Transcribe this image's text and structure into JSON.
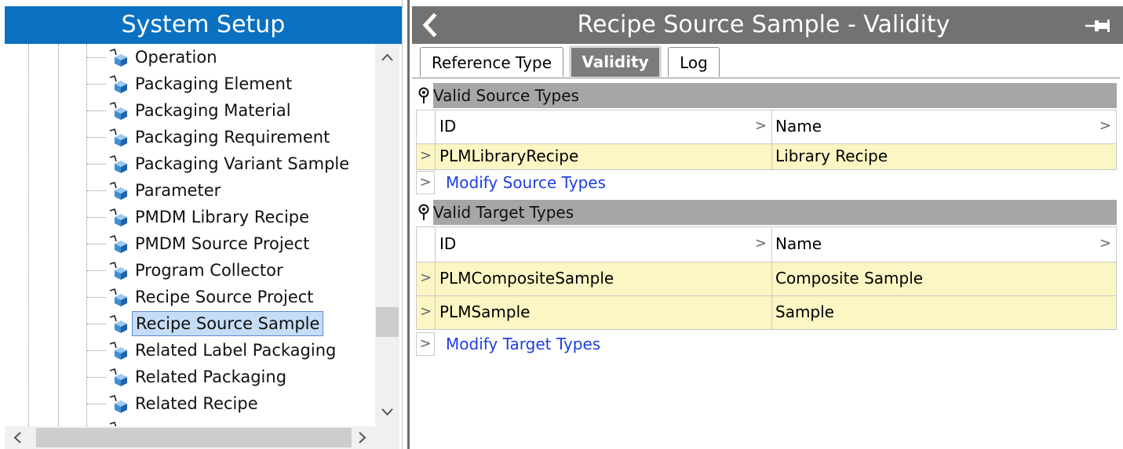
{
  "left_panel": {
    "title": "System Setup",
    "tree_items": [
      {
        "label": "Operation"
      },
      {
        "label": "Packaging Element"
      },
      {
        "label": "Packaging Material"
      },
      {
        "label": "Packaging Requirement"
      },
      {
        "label": "Packaging Variant Sample"
      },
      {
        "label": "Parameter"
      },
      {
        "label": "PMDM Library Recipe"
      },
      {
        "label": "PMDM Source Project"
      },
      {
        "label": "Program Collector"
      },
      {
        "label": "Recipe Source Project"
      },
      {
        "label": "Recipe Source Sample"
      },
      {
        "label": "Related Label Packaging"
      },
      {
        "label": "Related Packaging"
      },
      {
        "label": "Related Recipe"
      }
    ],
    "selected_item": "Recipe Source Sample",
    "scroll_up_icon": "^",
    "scroll_down_icon": "v",
    "scroll_left_icon": "<",
    "scroll_right_icon": ">"
  },
  "right_panel": {
    "title": "Recipe Source Sample - Validity",
    "back_icon": "<",
    "tabs": [
      {
        "label": "Reference Type"
      },
      {
        "label": "Validity"
      },
      {
        "label": "Log"
      }
    ],
    "active_tab": "Validity",
    "source_section": {
      "title": "Valid Source Types",
      "columns": [
        "ID",
        "Name"
      ],
      "rows": [
        {
          "id": "PLMLibraryRecipe",
          "name": "Library Recipe"
        }
      ],
      "modify_link": "Modify Source Types"
    },
    "target_section": {
      "title": "Valid Target Types",
      "columns": [
        "ID",
        "Name"
      ],
      "rows": [
        {
          "id": "PLMCompositeSample",
          "name": "Composite Sample"
        },
        {
          "id": "PLMSample",
          "name": "Sample"
        }
      ],
      "modify_link": "Modify Target Types"
    }
  },
  "colors": {
    "left_header_bg": "#0a70c2",
    "right_header_bg": "#727272",
    "row_highlight": "#fcf5c4",
    "link": "#1f3fe0",
    "selection_bg": "#c5dcf6"
  }
}
